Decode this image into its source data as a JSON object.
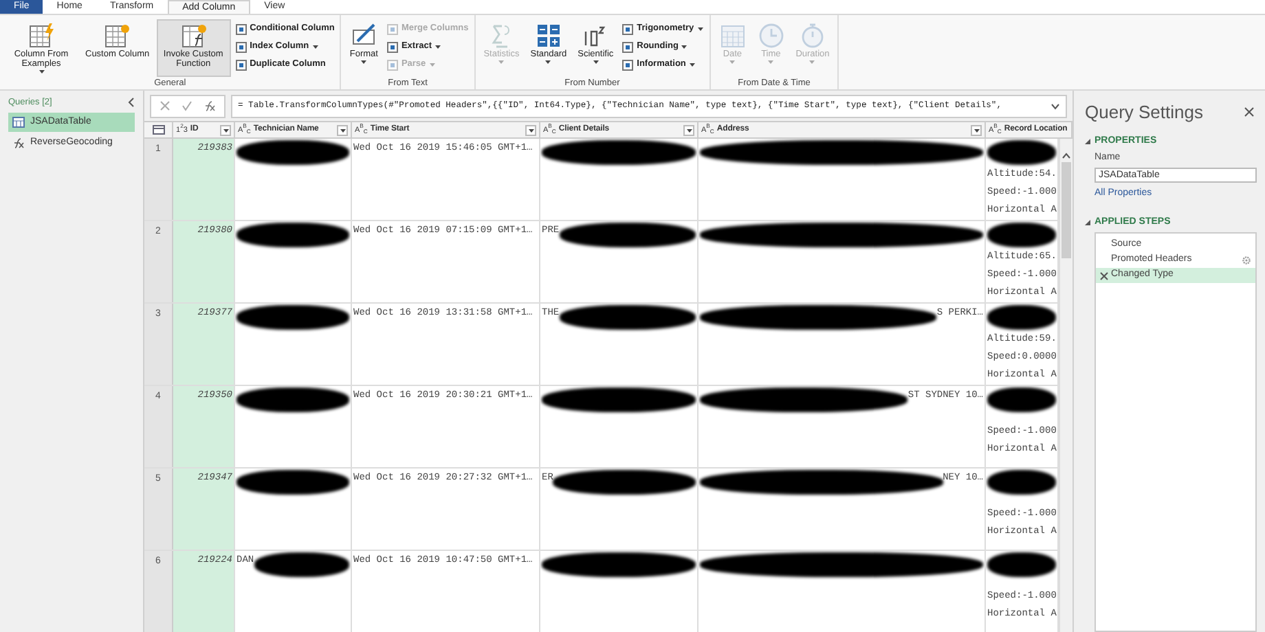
{
  "ribbon_tabs": [
    {
      "label": "File",
      "kind": "file",
      "selected": false
    },
    {
      "label": "Home",
      "kind": "tab",
      "selected": false
    },
    {
      "label": "Transform",
      "kind": "tab",
      "selected": false
    },
    {
      "label": "Add Column",
      "kind": "tab",
      "selected": true
    },
    {
      "label": "View",
      "kind": "tab",
      "selected": false
    }
  ],
  "ribbon_groups": [
    {
      "label": "General",
      "items": [
        {
          "kind": "large",
          "label": "Column From Examples",
          "dropdown": true,
          "disabled": false,
          "highlighted": false
        },
        {
          "kind": "large",
          "label": "Custom Column",
          "dropdown": false,
          "disabled": false,
          "highlighted": false
        },
        {
          "kind": "large",
          "label": "Invoke Custom Function",
          "dropdown": false,
          "disabled": false,
          "highlighted": true
        },
        {
          "kind": "small",
          "label": "Conditional Column",
          "dropdown": false,
          "disabled": false
        },
        {
          "kind": "small",
          "label": "Index Column",
          "dropdown": true,
          "disabled": false
        },
        {
          "kind": "small",
          "label": "Duplicate Column",
          "dropdown": false,
          "disabled": false
        }
      ]
    },
    {
      "label": "From Text",
      "items": [
        {
          "kind": "large",
          "label": "Format",
          "dropdown": true,
          "disabled": false,
          "highlighted": false
        },
        {
          "kind": "small",
          "label": "Merge Columns",
          "dropdown": false,
          "disabled": true
        },
        {
          "kind": "small",
          "label": "Extract",
          "dropdown": true,
          "disabled": false
        },
        {
          "kind": "small",
          "label": "Parse",
          "dropdown": true,
          "disabled": true
        }
      ]
    },
    {
      "label": "From Number",
      "items": [
        {
          "kind": "large",
          "label": "Statistics",
          "dropdown": true,
          "disabled": true,
          "highlighted": false
        },
        {
          "kind": "large",
          "label": "Standard",
          "dropdown": true,
          "disabled": false,
          "highlighted": false
        },
        {
          "kind": "large",
          "label": "Scientific",
          "dropdown": true,
          "disabled": false,
          "highlighted": false
        },
        {
          "kind": "small",
          "label": "Trigonometry",
          "dropdown": true,
          "disabled": false
        },
        {
          "kind": "small",
          "label": "Rounding",
          "dropdown": true,
          "disabled": false
        },
        {
          "kind": "small",
          "label": "Information",
          "dropdown": true,
          "disabled": false
        }
      ]
    },
    {
      "label": "From Date & Time",
      "items": [
        {
          "kind": "large",
          "label": "Date",
          "dropdown": true,
          "disabled": true,
          "highlighted": false
        },
        {
          "kind": "large",
          "label": "Time",
          "dropdown": true,
          "disabled": true,
          "highlighted": false
        },
        {
          "kind": "large",
          "label": "Duration",
          "dropdown": true,
          "disabled": true,
          "highlighted": false
        }
      ]
    }
  ],
  "queries": {
    "title": "Queries [2]",
    "items": [
      {
        "label": "JSADataTable",
        "kind": "table",
        "selected": true
      },
      {
        "label": "ReverseGeocoding",
        "kind": "function",
        "selected": false
      }
    ]
  },
  "formula_bar": {
    "formula": "= Table.TransformColumnTypes(#\"Promoted Headers\",{{\"ID\", Int64.Type}, {\"Technician Name\", type text}, {\"Time Start\", type text}, {\"Client Details\","
  },
  "table": {
    "columns": [
      {
        "type_badge": "1$^{2}$3",
        "label": "ID"
      },
      {
        "type_badge": "A$^{B}$$_{C}$",
        "label": "Technician Name"
      },
      {
        "type_badge": "A$^{B}$$_{C}$",
        "label": "Time Start"
      },
      {
        "type_badge": "A$^{B}$$_{C}$",
        "label": "Client Details"
      },
      {
        "type_badge": "A$^{B}$$_{C}$",
        "label": "Address"
      },
      {
        "type_badge": "A$^{B}$$_{C}$",
        "label": "Record Location"
      }
    ],
    "rows": [
      {
        "index": "1",
        "id": "219383",
        "time_start": "Wed Oct 16 2019 15:46:05 GMT+1…",
        "technician": {
          "redacted": true
        },
        "client": {
          "redacted": true
        },
        "address": {
          "redacted": true
        },
        "record_location": {
          "redacted": true,
          "lines": [
            "Altitude:54.",
            "Speed:-1.000",
            "Horizontal A"
          ]
        }
      },
      {
        "index": "2",
        "id": "219380",
        "time_start": "Wed Oct 16 2019 07:15:09 GMT+1…",
        "technician": {
          "redacted": true
        },
        "client": {
          "text": "PRE",
          "redacted": true
        },
        "address": {
          "redacted": true
        },
        "record_location": {
          "redacted": true,
          "lines": [
            "Altitude:65.",
            "Speed:-1.000",
            "Horizontal A"
          ]
        }
      },
      {
        "index": "3",
        "id": "219377",
        "time_start": "Wed Oct 16 2019 13:31:58 GMT+1…",
        "technician": {
          "redacted": true
        },
        "client": {
          "text": "THE",
          "redacted": true
        },
        "address": {
          "redacted": true,
          "text_end": "S PERKI…"
        },
        "record_location": {
          "redacted": true,
          "lines": [
            "Altitude:59.",
            "Speed:0.0000",
            "Horizontal A"
          ]
        }
      },
      {
        "index": "4",
        "id": "219350",
        "time_start": "Wed Oct 16 2019 20:30:21 GMT+1…",
        "technician": {
          "redacted": true
        },
        "client": {
          "redacted": true
        },
        "address": {
          "redacted": true,
          "text_end": "ST SYDNEY 10…"
        },
        "record_location": {
          "redacted": true,
          "lines": [
            "Speed:-1.000",
            "Horizontal A"
          ]
        }
      },
      {
        "index": "5",
        "id": "219347",
        "time_start": "Wed Oct 16 2019 20:27:32 GMT+1…",
        "technician": {
          "redacted": true
        },
        "client": {
          "text": "ER",
          "redacted": true
        },
        "address": {
          "redacted": true,
          "text_end": "NEY 10…"
        },
        "record_location": {
          "redacted": true,
          "lines": [
            "Speed:-1.000",
            "Horizontal A"
          ]
        }
      },
      {
        "index": "6",
        "id": "219224",
        "time_start": "Wed Oct 16 2019 10:47:50 GMT+1…",
        "technician": {
          "text": "DAN",
          "redacted": true
        },
        "client": {
          "redacted": true
        },
        "address": {
          "redacted": true
        },
        "record_location": {
          "redacted": true,
          "lines": [
            "Speed:-1.000",
            "Horizontal A"
          ]
        }
      }
    ]
  },
  "query_settings": {
    "title": "Query Settings",
    "properties": {
      "heading": "PROPERTIES",
      "name_label": "Name",
      "name_value": "JSADataTable",
      "link": "All Properties"
    },
    "applied_steps": {
      "heading": "APPLIED STEPS",
      "steps": [
        {
          "label": "Source",
          "has_settings": false,
          "selected": false
        },
        {
          "label": "Promoted Headers",
          "has_settings": true,
          "selected": false
        },
        {
          "label": "Changed Type",
          "has_settings": false,
          "selected": true
        }
      ]
    }
  }
}
